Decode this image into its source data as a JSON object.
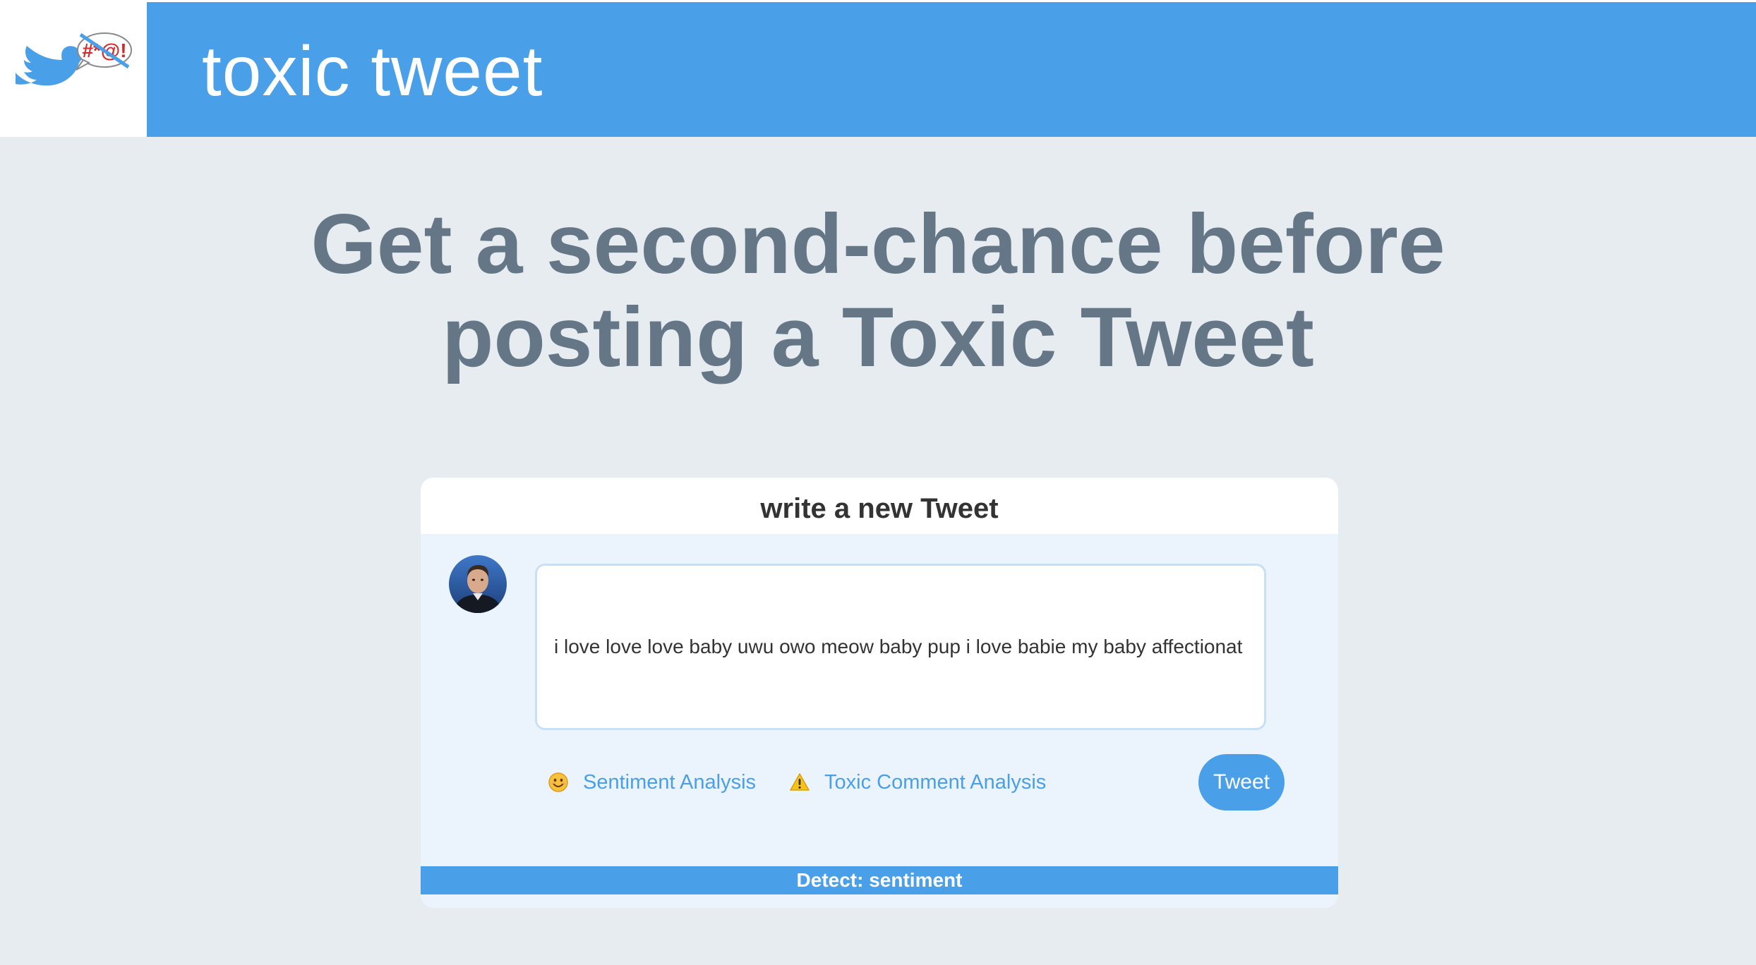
{
  "app": {
    "title": "toxic tweet",
    "logo_icon": "censored-bird-logo-icon",
    "logo_bubble_text": "#*@!"
  },
  "headline": {
    "line1": "Get a second-chance before",
    "line2": "posting a Toxic Tweet"
  },
  "composer": {
    "title": "write a new Tweet",
    "avatar_icon": "user-avatar",
    "tweet_text": "i love love love baby uwu owo meow baby pup i love babie my baby affectionat",
    "options": [
      {
        "label": "Sentiment Analysis",
        "icon": "smile-emoji-icon"
      },
      {
        "label": "Toxic Comment Analysis",
        "icon": "warning-icon"
      }
    ],
    "tweet_button": "Tweet",
    "detect_status": "Detect: sentiment"
  },
  "colors": {
    "brand": "#4a9fe9",
    "background": "#e6ecf0",
    "headline": "#657786",
    "card": "#ebf4fc"
  }
}
